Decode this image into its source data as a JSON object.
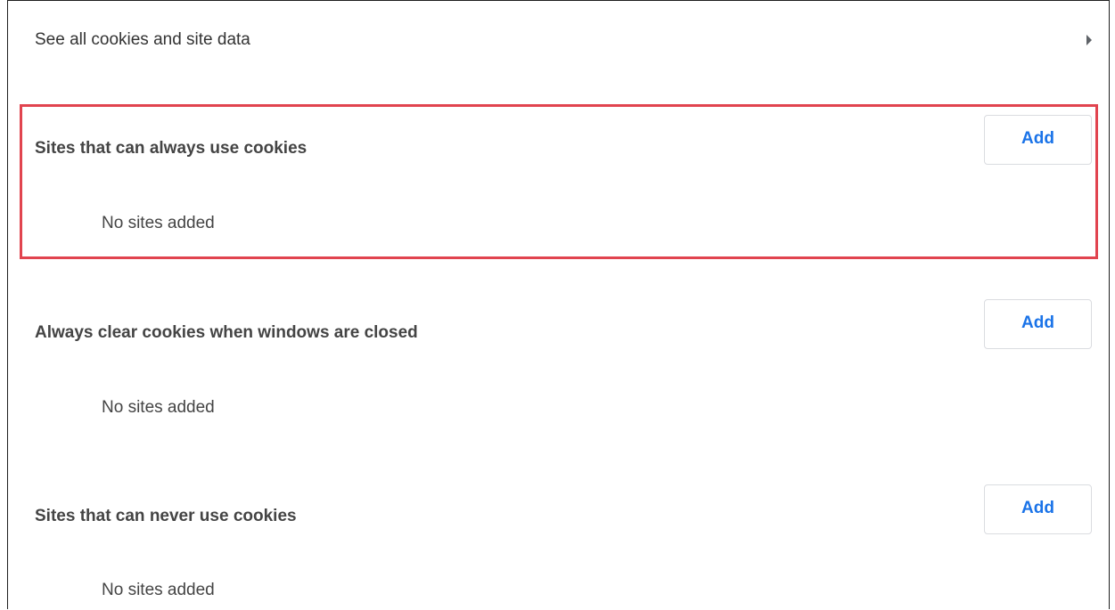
{
  "cookies_link": {
    "label": "See all cookies and site data",
    "icon": "arrow-right-icon"
  },
  "sections": [
    {
      "title": "Sites that can always use cookies",
      "add_label": "Add",
      "empty_text": "No sites added",
      "highlighted": true
    },
    {
      "title": "Always clear cookies when windows are closed",
      "add_label": "Add",
      "empty_text": "No sites added",
      "highlighted": false
    },
    {
      "title": "Sites that can never use cookies",
      "add_label": "Add",
      "empty_text": "No sites added",
      "highlighted": false
    }
  ],
  "colors": {
    "accent": "#1a73e8",
    "highlight": "#e1444f",
    "text": "#333333"
  }
}
